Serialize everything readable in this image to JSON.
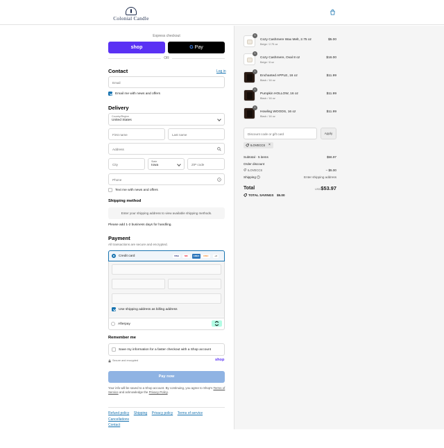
{
  "brand": {
    "name": "Colonial Candle"
  },
  "header": {
    "cart_icon": "shopping-bag-icon"
  },
  "express": {
    "title": "Express checkout",
    "shop_label": "shop",
    "gpay_g": "G",
    "gpay_label": "Pay",
    "or_label": "OR"
  },
  "contact": {
    "title": "Contact",
    "login_label": "Log in",
    "email_placeholder": "Email",
    "newsletter_label": "Email me with news and offers",
    "newsletter_checked": true
  },
  "delivery": {
    "title": "Delivery",
    "country_label": "Country/Region",
    "country_value": "United States",
    "first_name_placeholder": "First name",
    "last_name_placeholder": "Last name",
    "address_placeholder": "Address",
    "city_placeholder": "City",
    "state_label": "State",
    "state_value": "Iowa",
    "zip_placeholder": "ZIP code",
    "phone_placeholder": "Phone",
    "sms_label": "Text me with news and offers"
  },
  "shipping": {
    "title": "Shipping method",
    "placeholder_text": "Enter your shipping address to view available shipping methods.",
    "note": "Please add 1-2 business days for handling."
  },
  "payment": {
    "title": "Payment",
    "subtitle": "All transactions are secure and encrypted.",
    "credit_card_label": "Credit card",
    "card_brands": [
      {
        "name": "VISA",
        "color": "#1a1f71"
      },
      {
        "name": "MC",
        "color": "#eb001b"
      },
      {
        "name": "AMEX",
        "color": "#2e77bc"
      },
      {
        "name": "DISC",
        "color": "#f58220"
      },
      {
        "name": "+4",
        "color": "#ffffff"
      }
    ],
    "billing_same_label": "Use shipping address as billing address",
    "afterpay_label": "Afterpay",
    "accent_color": "#1773b0"
  },
  "remember": {
    "title": "Remember me",
    "save_label": "Save my information for a faster checkout with a Shop account",
    "secure_label": "Secure and encrypted",
    "shop_logo": "shop"
  },
  "pay_now": {
    "label": "Pay now",
    "disclaimer_1": "Your info will be saved to a Shop account. By continuing, you agree to Shop's",
    "terms_link": "Terms of Service",
    "disclaimer_2": "and acknowledge the",
    "privacy_link": "Privacy Policy",
    "disclaimer_3": "."
  },
  "footer": {
    "links": [
      "Refund policy",
      "Shipping",
      "Privacy policy",
      "Terms of service",
      "Cancellations",
      "Contact"
    ]
  },
  "order": {
    "items": [
      {
        "qty": "1",
        "name": "Cozy Cashmere Wax Melt, 2.75 oz",
        "variant": "Beige / 2.75 oz",
        "price": "$5.00",
        "dark": false
      },
      {
        "qty": "1",
        "name": "Cozy Cashmere, Oval 8 oz",
        "variant": "Beige / 8 oz",
        "price": "$16.00",
        "dark": false
      },
      {
        "qty": "1",
        "name": "Enchanted APPLE, 16 oz",
        "variant": "Black / 16 oz",
        "price": "$11.99",
        "dark": true
      },
      {
        "qty": "1",
        "name": "Pumpkin HOLLOW, 16 oz",
        "variant": "Black / 16 oz",
        "price": "$11.99",
        "dark": true
      },
      {
        "qty": "1",
        "name": "Howling WOODS, 16 oz",
        "variant": "Black / 16 oz",
        "price": "$11.99",
        "dark": true
      }
    ],
    "discount_placeholder": "Discount code or gift card",
    "apply_label": "Apply",
    "applied_code": "ILOVECCS",
    "subtotal_label": "Subtotal · 5 items",
    "subtotal_value": "$56.97",
    "order_discount_label": "Order discount",
    "order_discount_code": "ILOVECCS",
    "order_discount_value": "− $5.00",
    "shipping_label": "Shipping",
    "shipping_value": "Enter shipping address",
    "total_label": "Total",
    "currency": "USD",
    "total_value": "$53.97",
    "savings_label": "TOTAL SAVINGS",
    "savings_value": "$5.00"
  }
}
